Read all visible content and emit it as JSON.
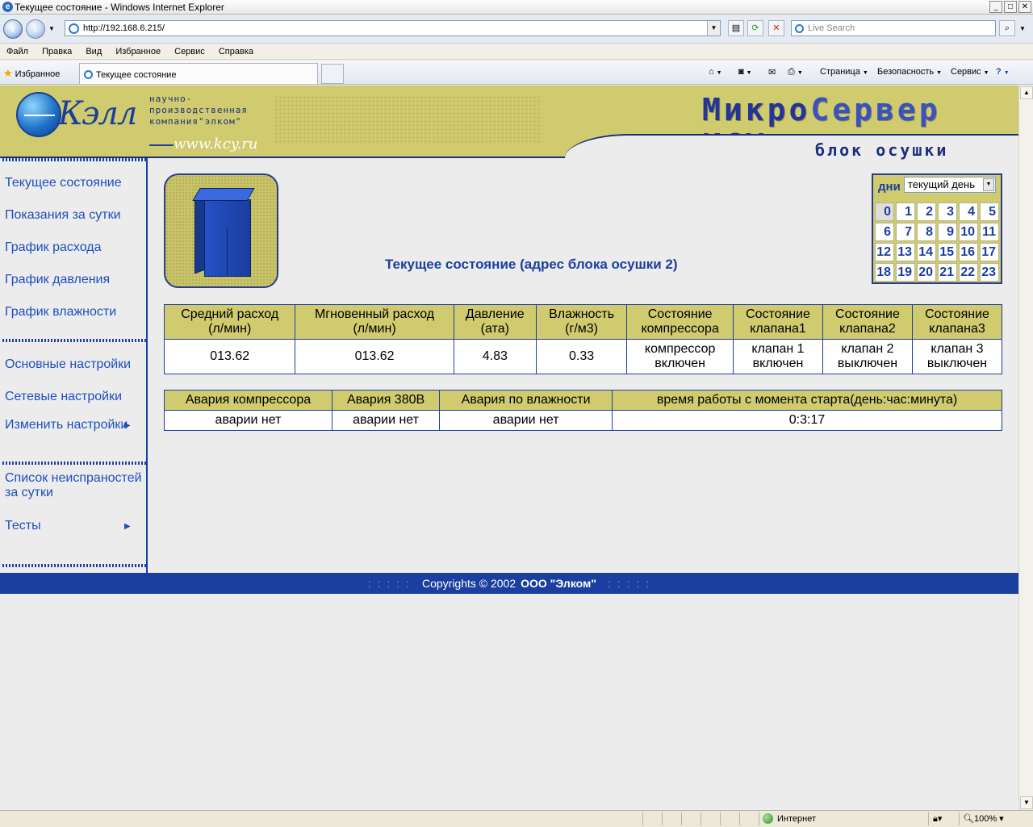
{
  "window": {
    "title": "Текущее состояние - Windows Internet Explorer",
    "controls": [
      "_",
      "□",
      "✕"
    ]
  },
  "address": {
    "url": "http://192.168.6.215/",
    "search_placeholder": "Live Search"
  },
  "menu": [
    "Файл",
    "Правка",
    "Вид",
    "Избранное",
    "Сервис",
    "Справка"
  ],
  "favorites": {
    "label": "Избранное",
    "tab_title": "Текущее состояние",
    "commands": [
      "Страница",
      "Безопасность",
      "Сервис"
    ]
  },
  "header": {
    "company_lines": [
      "научно-",
      "производственная",
      "компания\"элком\""
    ],
    "site_url": "www.kcy.ru",
    "product_a": "Микро",
    "product_b": "Сервер",
    "product_c": "КСУ",
    "block_name": "блок осушки"
  },
  "sidebar": {
    "group1": [
      "Текущее состояние",
      "Показания за сутки",
      "График расхода",
      "График давления",
      "График влажности"
    ],
    "group2": [
      "Основные настройки",
      "Сетевые настройки",
      "Изменить настройки"
    ],
    "group3": [
      "Список неиспраностей за сутки",
      "Тесты"
    ]
  },
  "main": {
    "title": "Текущее состояние (адрес блока осушки 2)"
  },
  "calendar": {
    "label": "дни",
    "selected_option": "текущий день",
    "days": [
      "0",
      "1",
      "2",
      "3",
      "4",
      "5",
      "6",
      "7",
      "8",
      "9",
      "10",
      "11",
      "12",
      "13",
      "14",
      "15",
      "16",
      "17",
      "18",
      "19",
      "20",
      "21",
      "22",
      "23"
    ],
    "selected_day": "0"
  },
  "table1": {
    "headers": [
      [
        "Средний расход",
        "(л/мин)"
      ],
      [
        "Мгновенный расход",
        "(л/мин)"
      ],
      [
        "Давление",
        "(ата)"
      ],
      [
        "Влажность",
        "(г/м3)"
      ],
      [
        "Состояние",
        "компрессора"
      ],
      [
        "Состояние",
        "клапана1"
      ],
      [
        "Состояние",
        "клапана2"
      ],
      [
        "Состояние",
        "клапана3"
      ]
    ],
    "row": [
      [
        "013.62"
      ],
      [
        "013.62"
      ],
      [
        "4.83"
      ],
      [
        "0.33"
      ],
      [
        "компрессор",
        "включен"
      ],
      [
        "клапан 1",
        "включен"
      ],
      [
        "клапан 2",
        "выключен"
      ],
      [
        "клапан 3",
        "выключен"
      ]
    ]
  },
  "table2": {
    "headers": [
      "Авария компрессора",
      "Авария 380В",
      "Авария по влажности",
      "время работы с момента старта(день:час:минута)"
    ],
    "row": [
      "аварии нет",
      "аварии нет",
      "аварии нет",
      "0:3:17"
    ]
  },
  "footer": {
    "dots": ": : : : :",
    "copyright": "Copyrights  ©  2002",
    "company": "ООО \"Элком\""
  },
  "status": {
    "zone": "Интернет",
    "zoom": "100%"
  },
  "colors": {
    "brand_blue": "#1b3fa0",
    "khaki": "#cfcb6e",
    "link_blue": "#1d4fbf"
  }
}
